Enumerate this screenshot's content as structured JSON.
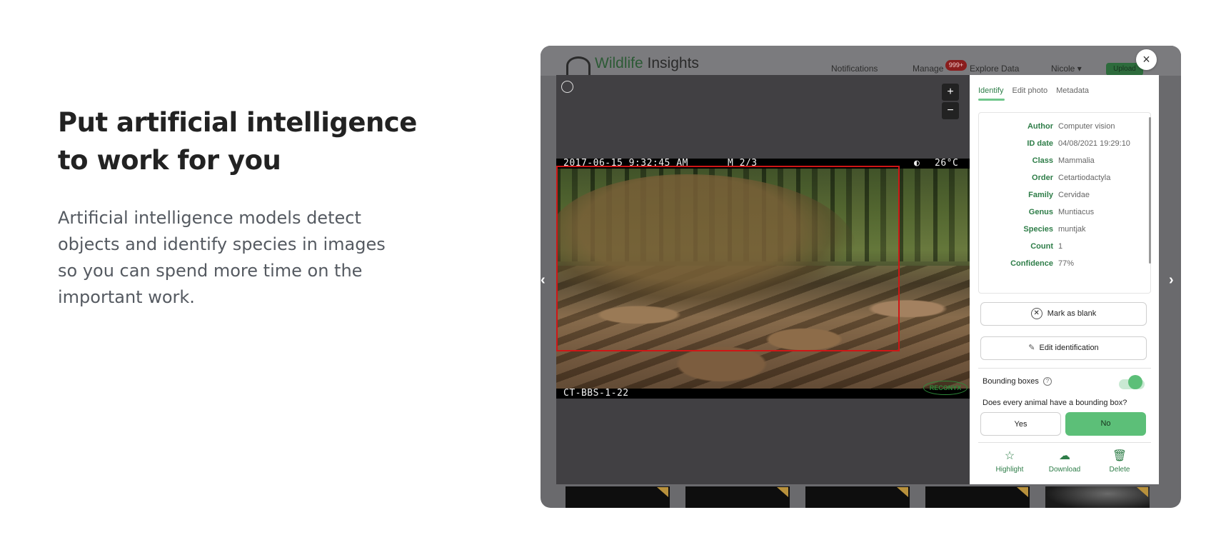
{
  "hero": {
    "title_line1": "Put artificial intelligence",
    "title_line2": "to work for you",
    "body": "Artificial intelligence models detect objects and identify species in images so you can spend more time on the important work."
  },
  "app": {
    "brand_word1": "Wildlife",
    "brand_word2": "Insights",
    "nav": {
      "notifications": "Notifications",
      "manage": "Manage",
      "manage_badge": "999+",
      "explore": "Explore Data",
      "user": "Nicole",
      "upload": "Upload"
    },
    "close_glyph": "×",
    "viewer": {
      "zoom_in": "+",
      "zoom_out": "−",
      "timestamp": "2017-06-15 9:32:45 AM",
      "sequence": "M 2/3",
      "temp_icon": "◐",
      "temperature": "26°C",
      "camera_id": "CT-BBS-1-22",
      "camera_brand": "RECONYX",
      "prev_glyph": "‹",
      "next_glyph": "›"
    },
    "panel": {
      "tabs": [
        "Identify",
        "Edit photo",
        "Metadata"
      ],
      "active_tab": "Identify",
      "info": [
        {
          "key": "Author",
          "value": "Computer vision"
        },
        {
          "key": "ID date",
          "value": "04/08/2021 19:29:10"
        },
        {
          "key": "Class",
          "value": "Mammalia"
        },
        {
          "key": "Order",
          "value": "Cetartiodactyla"
        },
        {
          "key": "Family",
          "value": "Cervidae"
        },
        {
          "key": "Genus",
          "value": "Muntiacus"
        },
        {
          "key": "Species",
          "value": "muntjak"
        },
        {
          "key": "Count",
          "value": "1"
        },
        {
          "key": "Confidence",
          "value": "77%"
        }
      ],
      "mark_blank": "Mark as blank",
      "edit_identification": "Edit identification",
      "bounding_boxes": "Bounding boxes",
      "bounding_boxes_on": true,
      "question": "Does every animal have a bounding box?",
      "yes": "Yes",
      "no": "No",
      "actions": [
        {
          "label": "Highlight",
          "icon": "star-icon"
        },
        {
          "label": "Download",
          "icon": "cloud-download-icon"
        },
        {
          "label": "Delete",
          "icon": "trash-icon"
        }
      ]
    },
    "colors": {
      "accent_green": "#5cbf78",
      "label_green": "#2e7d48",
      "bbox_red": "#d01616"
    }
  }
}
